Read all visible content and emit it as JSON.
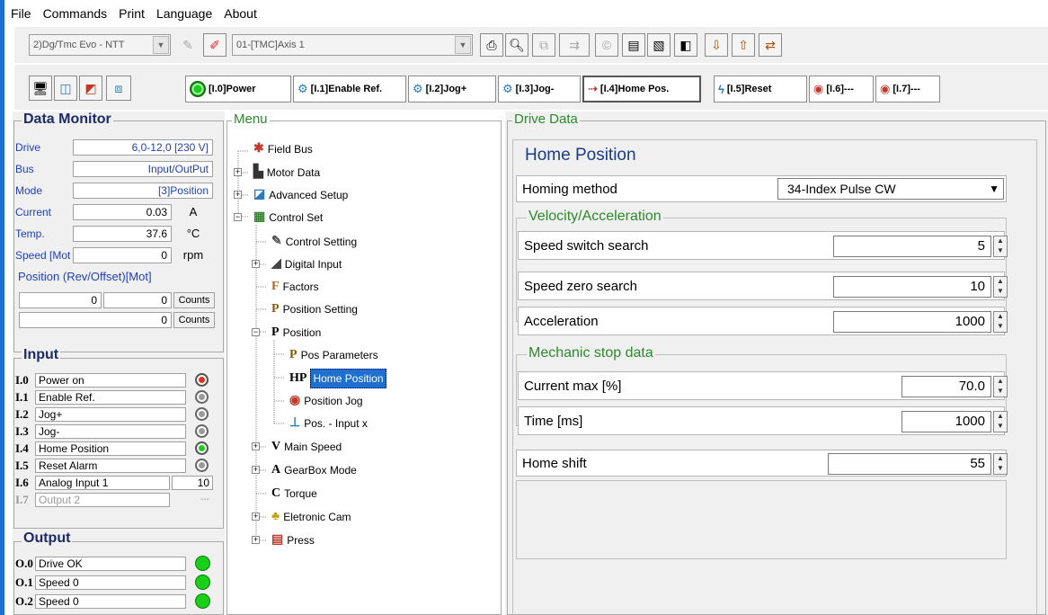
{
  "menu": [
    "File",
    "Commands",
    "Print",
    "Language",
    "About"
  ],
  "toolbar": {
    "drive_combo": "2)Dg/Tmc Evo - NTT",
    "axis_combo": "01-[TMC]Axis 1"
  },
  "input_buttons": [
    {
      "label": "[I.0]Power"
    },
    {
      "label": "[I.1]Enable Ref."
    },
    {
      "label": "[I.2]Jog+"
    },
    {
      "label": "[I.3]Jog-"
    },
    {
      "label": "[I.4]Home Pos."
    },
    {
      "label": "[I.5]Reset"
    },
    {
      "label": "[I.6]---"
    },
    {
      "label": "[I.7]---"
    }
  ],
  "data_monitor": {
    "title": "Data Monitor",
    "rows": [
      {
        "label": "Drive",
        "value": "6,0-12,0 [230 V]",
        "unit": ""
      },
      {
        "label": "Bus",
        "value": "Input/OutPut",
        "unit": ""
      },
      {
        "label": "Mode",
        "value": "[3]Position",
        "unit": ""
      },
      {
        "label": "Current",
        "value": "0.03",
        "unit": "A"
      },
      {
        "label": "Temp.",
        "value": "37.6",
        "unit": "°C"
      },
      {
        "label": "Speed [Mot",
        "value": "0",
        "unit": "rpm"
      }
    ],
    "position_title": "Position (Rev/Offset)[Mot]",
    "position_rows": [
      {
        "rev": "0",
        "offset": "0",
        "unit": "Counts"
      },
      {
        "rev": "",
        "offset": "0",
        "unit": "Counts"
      }
    ]
  },
  "input": {
    "title": "Input",
    "rows": [
      {
        "id": "I.0",
        "name": "Power on",
        "led": "red"
      },
      {
        "id": "I.1",
        "name": "Enable Ref.",
        "led": "gray"
      },
      {
        "id": "I.2",
        "name": "Jog+",
        "led": "gray"
      },
      {
        "id": "I.3",
        "name": "Jog-",
        "led": "gray"
      },
      {
        "id": "I.4",
        "name": "Home Position",
        "led": "green"
      },
      {
        "id": "I.5",
        "name": "Reset Alarm",
        "led": "gray"
      },
      {
        "id": "I.6",
        "name": "Analog Input 1",
        "value": "10"
      },
      {
        "id": "I.7",
        "name": "Output 2",
        "value": "---",
        "disabled": true
      }
    ]
  },
  "output": {
    "title": "Output",
    "rows": [
      {
        "id": "O.0",
        "name": "Drive OK",
        "led": "green"
      },
      {
        "id": "O.1",
        "name": "Speed 0",
        "led": "green"
      },
      {
        "id": "O.2",
        "name": "Speed 0",
        "led": "green"
      }
    ]
  },
  "menu_tree": {
    "title": "Menu",
    "items": [
      {
        "label": "Field Bus",
        "icon": "fieldbus-icon",
        "glyph": "✱",
        "color": "#c0392b",
        "level": 0,
        "expander": "none"
      },
      {
        "label": "Motor Data",
        "icon": "motor-icon",
        "glyph": "▙",
        "color": "#333333",
        "level": 0,
        "expander": "plus"
      },
      {
        "label": "Advanced Setup",
        "icon": "advanced-icon",
        "glyph": "◪",
        "color": "#2a7abf",
        "level": 0,
        "expander": "plus"
      },
      {
        "label": "Control Set",
        "icon": "control-set-icon",
        "glyph": "▦",
        "color": "#2e8b2e",
        "level": 0,
        "expander": "minus"
      },
      {
        "label": "Control Setting",
        "icon": "control-setting-icon",
        "glyph": "✎",
        "color": "#555555",
        "level": 1,
        "expander": "none"
      },
      {
        "label": "Digital Input",
        "icon": "digital-input-icon",
        "glyph": "◢",
        "color": "#444444",
        "level": 1,
        "expander": "plus"
      },
      {
        "label": "Factors",
        "icon": "factors-icon",
        "glyph": "F",
        "color": "#b5651d",
        "level": 1,
        "expander": "none"
      },
      {
        "label": "Position Setting",
        "icon": "position-setting-icon",
        "glyph": "P",
        "color": "#8b5a00",
        "level": 1,
        "expander": "none"
      },
      {
        "label": "Position",
        "icon": "position-icon",
        "glyph": "P",
        "color": "#000000",
        "level": 1,
        "expander": "minus"
      },
      {
        "label": "Pos Parameters",
        "icon": "pos-parameters-icon",
        "glyph": "P",
        "color": "#8b5a00",
        "level": 2,
        "expander": "none"
      },
      {
        "label": "Home Position",
        "icon": "home-position-icon",
        "glyph": "HP",
        "color": "#000000",
        "level": 2,
        "expander": "none",
        "selected": true
      },
      {
        "label": "Position Jog",
        "icon": "position-jog-icon",
        "glyph": "◉",
        "color": "#c0392b",
        "level": 2,
        "expander": "none"
      },
      {
        "label": "Pos. - Input x",
        "icon": "pos-input-icon",
        "glyph": "⊥",
        "color": "#2a7abf",
        "level": 2,
        "expander": "none"
      },
      {
        "label": "Main Speed",
        "icon": "main-speed-icon",
        "glyph": "V",
        "color": "#000000",
        "level": 1,
        "expander": "plus"
      },
      {
        "label": "GearBox Mode",
        "icon": "gearbox-icon",
        "glyph": "A",
        "color": "#000000",
        "level": 1,
        "expander": "plus"
      },
      {
        "label": "Torque",
        "icon": "torque-icon",
        "glyph": "C",
        "color": "#000000",
        "level": 1,
        "expander": "none"
      },
      {
        "label": "Eletronic Cam",
        "icon": "cam-icon",
        "glyph": "♣",
        "color": "#c8a000",
        "level": 1,
        "expander": "plus"
      },
      {
        "label": "Press",
        "icon": "press-icon",
        "glyph": "▤",
        "color": "#c0392b",
        "level": 1,
        "expander": "plus"
      }
    ]
  },
  "drive_data": {
    "title": "Drive Data",
    "section_title": "Home Position",
    "homing_label": "Homing method",
    "homing_value": "34-Index Pulse CW",
    "velocity_title": "Velocity/Acceleration",
    "velocity_fields": [
      {
        "label": "Speed switch search",
        "value": "5"
      },
      {
        "label": "Speed zero search",
        "value": "10"
      },
      {
        "label": "Acceleration",
        "value": "1000"
      }
    ],
    "mechanic_title": "Mechanic stop data",
    "mechanic_fields": [
      {
        "label": "Current max [%]",
        "value": "70.0"
      },
      {
        "label": "Time [ms]",
        "value": "1000"
      }
    ],
    "home_shift_label": "Home shift",
    "home_shift_value": "55"
  },
  "colors": {
    "accent_blue": "#1e6fd0",
    "label_blue": "#1f3fbf",
    "section_green": "#2b8a2b",
    "led_green": "#18d018",
    "led_red": "#e0301e",
    "led_gray": "#9a9a9a",
    "selection": "#1e6fd0"
  }
}
